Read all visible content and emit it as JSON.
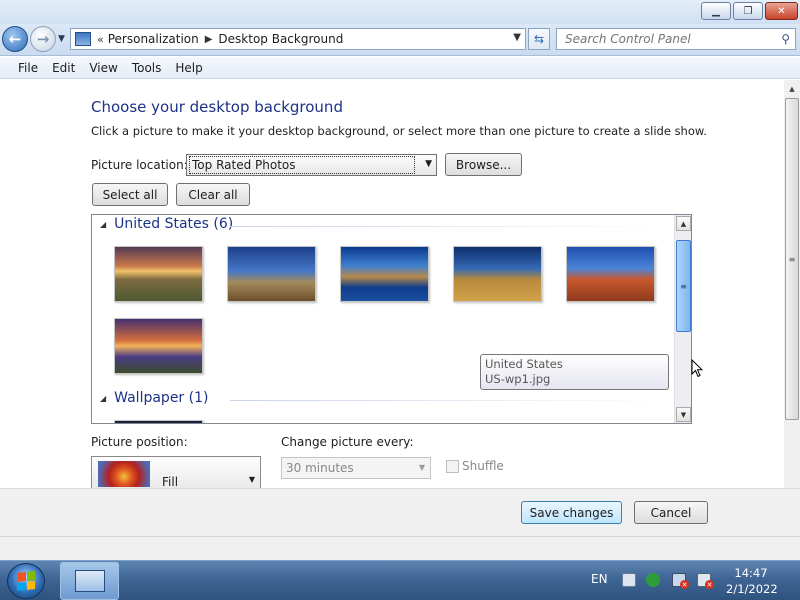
{
  "window": {
    "min_label": "▁",
    "max_label": "❐",
    "close_label": "✕"
  },
  "nav": {
    "breadcrumb_prefix": "«",
    "breadcrumb": [
      "Personalization",
      "Desktop Background"
    ],
    "search_placeholder": "Search Control Panel"
  },
  "menu": [
    "File",
    "Edit",
    "View",
    "Tools",
    "Help"
  ],
  "page": {
    "title": "Choose your desktop background",
    "description": "Click a picture to make it your desktop background, or select more than one picture to create a slide show.",
    "location_label": "Picture location:",
    "location_value": "Top Rated Photos",
    "browse_label": "Browse...",
    "select_all_label": "Select all",
    "clear_all_label": "Clear all"
  },
  "groups": [
    {
      "name": "United States (6)",
      "thumbnails": 6
    },
    {
      "name": "Wallpaper (1)",
      "thumbnails": 1
    }
  ],
  "tooltip": {
    "line1": "United States",
    "line2": "US-wp1.jpg"
  },
  "options": {
    "position_label": "Picture position:",
    "position_value": "Fill",
    "change_label": "Change picture every:",
    "change_value": "30 minutes",
    "shuffle_label": "Shuffle",
    "shuffle_checked": false
  },
  "buttons": {
    "save": "Save changes",
    "cancel": "Cancel"
  },
  "taskbar": {
    "language": "EN",
    "time": "14:47",
    "date": "2/1/2022"
  },
  "colors": {
    "title_blue": "#1e3287",
    "taskbar": "#3f6594"
  }
}
